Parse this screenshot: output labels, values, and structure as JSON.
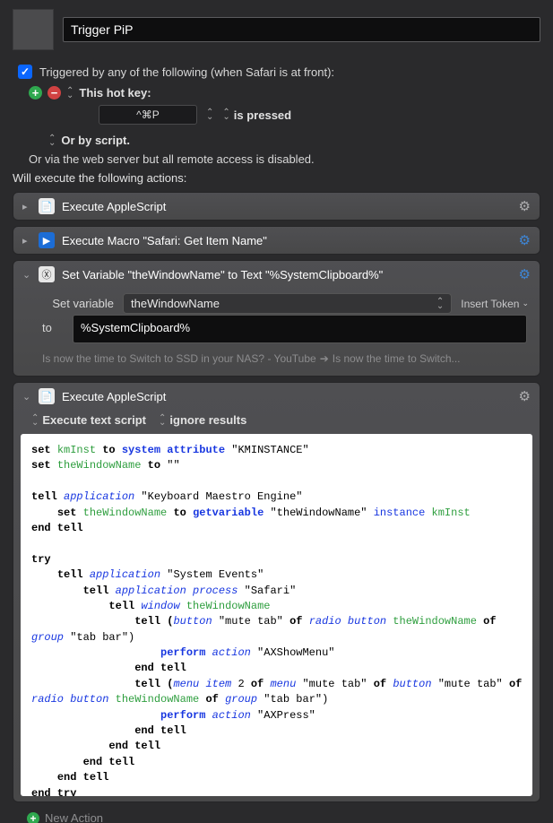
{
  "header": {
    "title_value": "Trigger PiP"
  },
  "trigger_section": {
    "checkbox_label": "Triggered by any of the following (when Safari is at front):",
    "hotkey_label": "This hot key:",
    "hotkey_value": "^⌘P",
    "hotkey_mode": "is pressed",
    "or_script": "Or by script.",
    "webserver_note": "Or via the web server but all remote access is disabled."
  },
  "actions_label": "Will execute the following actions:",
  "actions": [
    {
      "title": "Execute AppleScript"
    },
    {
      "title": "Execute Macro \"Safari: Get Item Name\""
    }
  ],
  "set_var_action": {
    "title": "Set Variable \"theWindowName\" to Text \"%SystemClipboard%\"",
    "set_variable_label": "Set variable",
    "variable_name": "theWindowName",
    "insert_token": "Insert Token",
    "to_label": "to",
    "to_value": "%SystemClipboard%",
    "preview_left": "Is now the time to Switch to SSD in your NAS? - YouTube",
    "preview_right": "Is now the time to Switch..."
  },
  "script_action": {
    "title": "Execute AppleScript",
    "opt1": "Execute text script",
    "opt2": "ignore results"
  },
  "footer": {
    "new_action": "New Action"
  },
  "code": {
    "l1a": "set ",
    "l1b": "kmInst",
    "l1c": " to ",
    "l1d": "system attribute",
    "l1e": " \"KMINSTANCE\"",
    "l2a": "set ",
    "l2b": "theWindowName",
    "l2c": " to ",
    "l2d": "\"\"",
    "l3a": "tell ",
    "l3b": "application",
    "l3c": " \"Keyboard Maestro Engine\"",
    "l4a": "set ",
    "l4b": "theWindowName",
    "l4c": " to ",
    "l4d": "getvariable",
    "l4e": " \"theWindowName\" ",
    "l4f": "instance",
    "l4g": " kmInst",
    "l5": "end tell",
    "l6": "try",
    "l7a": "tell ",
    "l7b": "application",
    "l7c": " \"System Events\"",
    "l8a": "tell ",
    "l8b": "application process",
    "l8c": " \"Safari\"",
    "l9a": "tell ",
    "l9b": "window",
    "l9c": " theWindowName",
    "l10a": "tell (",
    "l10b": "button",
    "l10c": " \"mute tab\" ",
    "l10d": "of ",
    "l10e": "radio button",
    "l10f": " theWindowName",
    "l10g": " of ",
    "l10h": "group",
    "l10i": " \"tab bar\")",
    "l11a": "perform ",
    "l11b": "action",
    "l11c": " \"AXShowMenu\"",
    "l12": "end tell",
    "l13a": "tell (",
    "l13b": "menu item",
    "l13c": " 2 ",
    "l13d": "of ",
    "l13e": "menu",
    "l13f": " \"mute tab\" ",
    "l13g": "of ",
    "l13h": "button",
    "l13i": " \"mute tab\" ",
    "l13j": "of ",
    "l13k": "radio button",
    "l13l": " theWindowName",
    "l13m": " of ",
    "l13n": "group",
    "l13o": " \"tab bar\")",
    "l14a": "perform ",
    "l14b": "action",
    "l14c": " \"AXPress\"",
    "l15": "end tell",
    "l16": "end tell",
    "l17": "end tell",
    "l18": "end tell",
    "l19": "end try"
  }
}
